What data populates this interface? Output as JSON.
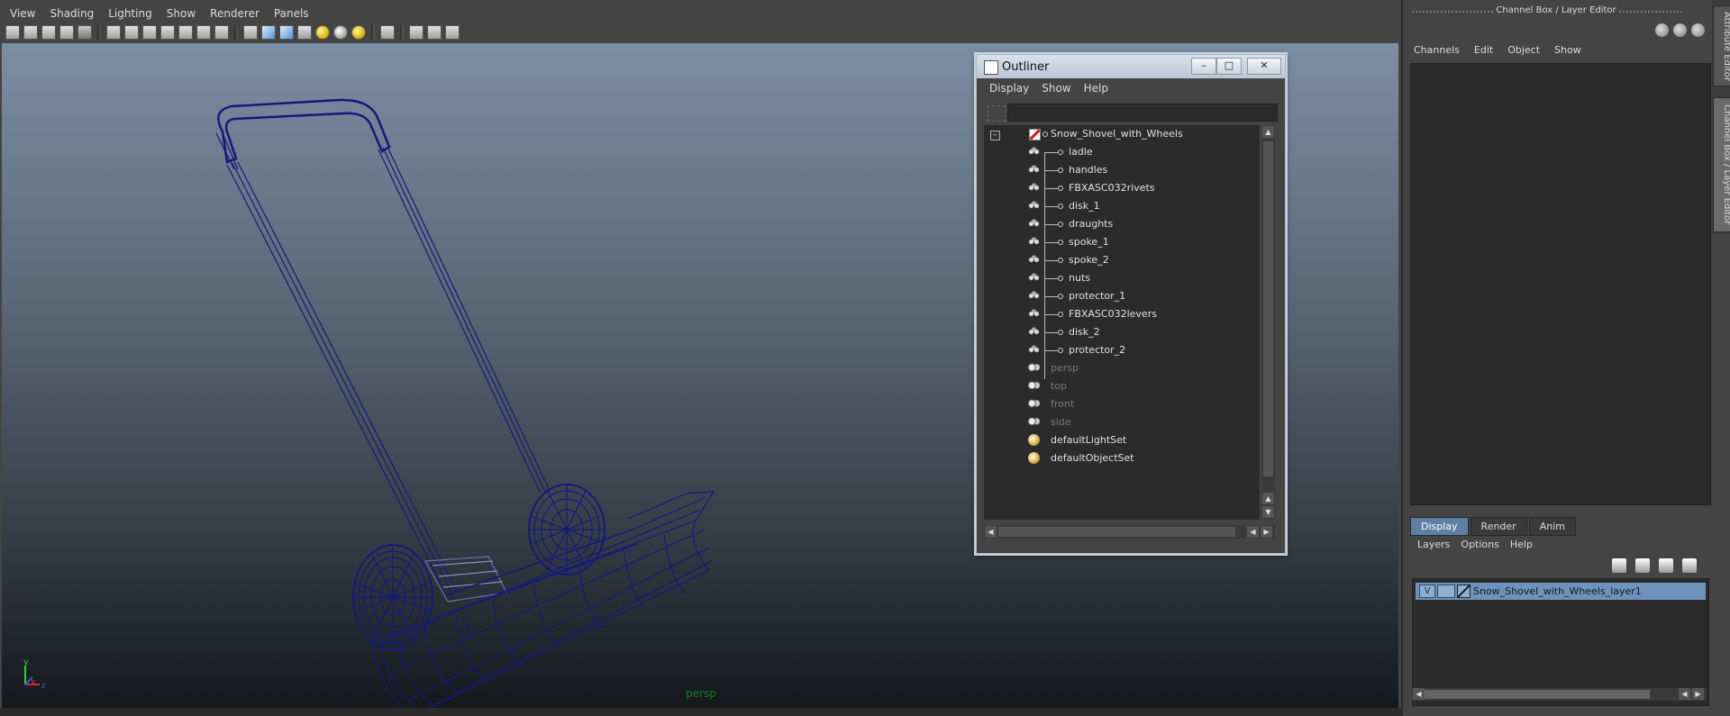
{
  "viewport": {
    "menu": [
      "View",
      "Shading",
      "Lighting",
      "Show",
      "Renderer",
      "Panels"
    ],
    "camera_label": "persp",
    "axis": {
      "y": "y",
      "x": "x",
      "z": "z"
    }
  },
  "outliner": {
    "title": "Outliner",
    "window_buttons": {
      "minimize": "–",
      "maximize": "□",
      "close": "✕"
    },
    "menu": [
      "Display",
      "Show",
      "Help"
    ],
    "search_value": "",
    "collapse_symbol": "–",
    "root": "Snow_Shovel_with_Wheels",
    "children": [
      "ladle",
      "handles",
      "FBXASC032rivets",
      "disk_1",
      "draughts",
      "spoke_1",
      "spoke_2",
      "nuts",
      "protector_1",
      "FBXASC032levers",
      "disk_2",
      "protector_2"
    ],
    "cameras": [
      "persp",
      "top",
      "front",
      "side"
    ],
    "sets": [
      "defaultLightSet",
      "defaultObjectSet"
    ]
  },
  "channel_box": {
    "title": "Channel Box / Layer Editor",
    "menu": [
      "Channels",
      "Edit",
      "Object",
      "Show"
    ],
    "side_tabs": [
      "Attribute Editor",
      "Channel Box / Layer Editor"
    ]
  },
  "layer_editor": {
    "tabs": [
      "Display",
      "Render",
      "Anim"
    ],
    "active_tab": "Display",
    "menu": [
      "Layers",
      "Options",
      "Help"
    ],
    "layer": {
      "visible_flag": "V",
      "name": "Snow_Shovel_with_Wheels_layer1"
    }
  },
  "colors": {
    "wireframe": "#141a7a",
    "selected_layer": "#6e93bb",
    "active_tab": "#5e7fa3",
    "camera_label": "#1d7a1d"
  }
}
